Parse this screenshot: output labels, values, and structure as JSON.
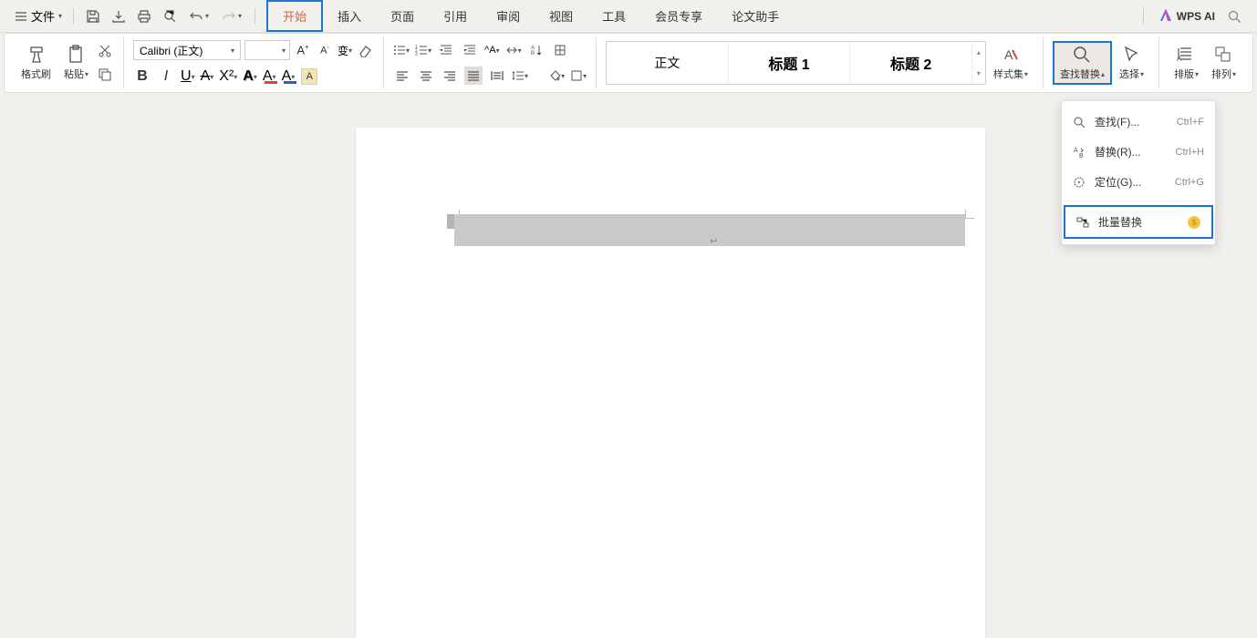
{
  "topbar": {
    "file_label": "文件",
    "tabs": [
      "开始",
      "插入",
      "页面",
      "引用",
      "审阅",
      "视图",
      "工具",
      "会员专享",
      "论文助手"
    ],
    "active_index": 0,
    "highlighted_index": 0,
    "wps_ai_label": "WPS AI"
  },
  "ribbon": {
    "format_painter": "格式刷",
    "paste": "粘贴",
    "font_name": "Calibri (正文)",
    "font_size": "",
    "styles": {
      "normal": "正文",
      "h1": "标题 1",
      "h2": "标题 2"
    },
    "style_set": "样式集",
    "find_replace": "查找替换",
    "select": "选择",
    "layout": "排版",
    "arrange": "排列"
  },
  "dropdown": {
    "items": [
      {
        "label": "查找(F)...",
        "shortcut": "Ctrl+F",
        "icon": "search"
      },
      {
        "label": "替换(R)...",
        "shortcut": "Ctrl+H",
        "icon": "replace"
      },
      {
        "label": "定位(G)...",
        "shortcut": "Ctrl+G",
        "icon": "target"
      }
    ],
    "batch_label": "批量替换"
  }
}
